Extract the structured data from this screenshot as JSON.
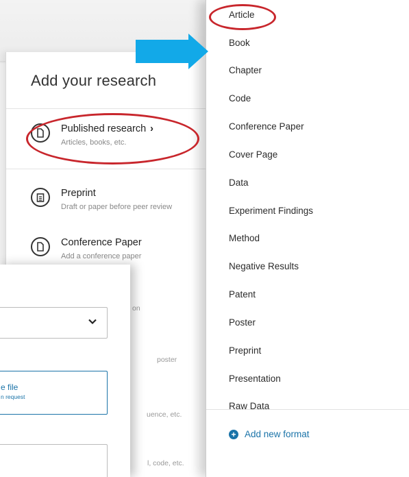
{
  "research_panel": {
    "title": "Add your research",
    "items": [
      {
        "title": "Published research",
        "subtitle": "Articles, books, etc.",
        "icon": "document-icon",
        "has_chevron": true
      },
      {
        "title": "Preprint",
        "subtitle": "Draft or paper before peer review",
        "icon": "clipboard-icon"
      },
      {
        "title": "Conference Paper",
        "subtitle": "Add a conference paper",
        "icon": "document-icon"
      }
    ],
    "chevron": "›",
    "faded": [
      "on",
      "poster",
      "uence, etc.",
      "l, code, etc."
    ]
  },
  "format_list": {
    "items": [
      "Article",
      "Book",
      "Chapter",
      "Code",
      "Conference Paper",
      "Cover Page",
      "Data",
      "Experiment Findings",
      "Method",
      "Negative Results",
      "Patent",
      "Poster",
      "Preprint",
      "Presentation",
      "Raw Data"
    ],
    "add_label": "Add new format"
  },
  "modal": {
    "file_title": "e file",
    "file_subtitle": "n request"
  },
  "colors": {
    "annotation_red": "#c8262c",
    "arrow_blue": "#12a9e8",
    "link_blue": "#1a73a8"
  }
}
